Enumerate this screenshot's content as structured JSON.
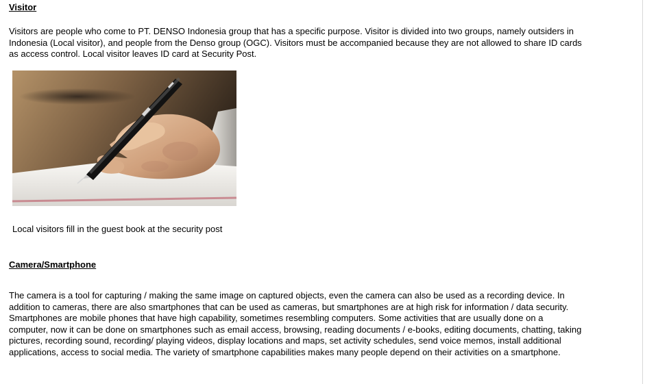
{
  "sections": [
    {
      "heading": "Visitor",
      "paragraph": "Visitors are people who come to PT. DENSO Indonesia group that has a specific purpose. Visitor is divided into two groups, namely outsiders in Indonesia (Local visitor), and people from the Denso group (OGC). Visitors must be accompanied because they are not allowed to share ID cards as access control. Local visitor leaves ID card at Security Post.",
      "image": {
        "subject": "hand holding fountain pen writing on paper"
      },
      "caption": "Local visitors fill in the guest book at the security post"
    },
    {
      "heading": "Camera/Smartphone",
      "paragraph": "The camera is a tool for capturing / making the same image on captured objects, even the camera can also be used as a recording device. In addition to cameras, there are also smartphones that can be used as cameras, but smartphones are at high risk for information / data security. Smartphones are mobile phones that have high capability, sometimes resembling computers. Some activities that are usually done on a computer, now it can be done on smartphones such as email access, browsing, reading documents / e-books, editing documents, chatting, taking pictures, recording sound, recording/ playing videos, display locations and maps, set activity schedules, send voice memos, install additional applications, access to social media. The variety of smartphone capabilities makes many people depend on their activities on a smartphone."
    }
  ]
}
